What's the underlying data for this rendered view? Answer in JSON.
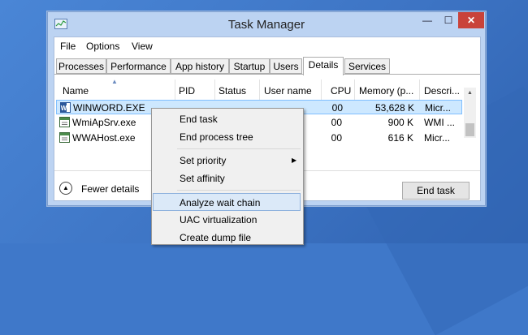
{
  "window": {
    "title": "Task Manager",
    "min_glyph": "—",
    "max_glyph": "☐",
    "close_glyph": "✕"
  },
  "menubar": [
    "File",
    "Options",
    "View"
  ],
  "tabs": [
    "Processes",
    "Performance",
    "App history",
    "Startup",
    "Users",
    "Details",
    "Services"
  ],
  "active_tab": "Details",
  "columns": [
    "Name",
    "PID",
    "Status",
    "User name",
    "CPU",
    "Memory (p...",
    "Descri..."
  ],
  "rows": [
    {
      "name": "WINWORD.EXE",
      "pid": "",
      "status": "",
      "user": "",
      "cpu": "00",
      "memory": "53,628 K",
      "desc": "Micr...",
      "icon": "word-doc-icon",
      "selected": true
    },
    {
      "name": "WmiApSrv.exe",
      "pid": "",
      "status": "",
      "user": "",
      "cpu": "00",
      "memory": "900 K",
      "desc": "WMI ...",
      "icon": "app-window-icon",
      "selected": false
    },
    {
      "name": "WWAHost.exe",
      "pid": "",
      "status": "",
      "user": "",
      "cpu": "00",
      "memory": "616 K",
      "desc": "Micr...",
      "icon": "app-window-icon",
      "selected": false
    }
  ],
  "footer": {
    "fewer_details": "Fewer details",
    "end_task": "End task"
  },
  "context_menu": [
    {
      "label": "End task"
    },
    {
      "label": "End process tree"
    },
    {
      "label": "Set priority",
      "submenu": true
    },
    {
      "label": "Set affinity"
    },
    {
      "label": "Analyze wait chain",
      "highlighted": true
    },
    {
      "label": "UAC virtualization"
    },
    {
      "label": "Create dump file"
    }
  ],
  "colors": {
    "selection": "#cde8ff",
    "close_button": "#c9433a",
    "desktop": "#3f78c9"
  }
}
